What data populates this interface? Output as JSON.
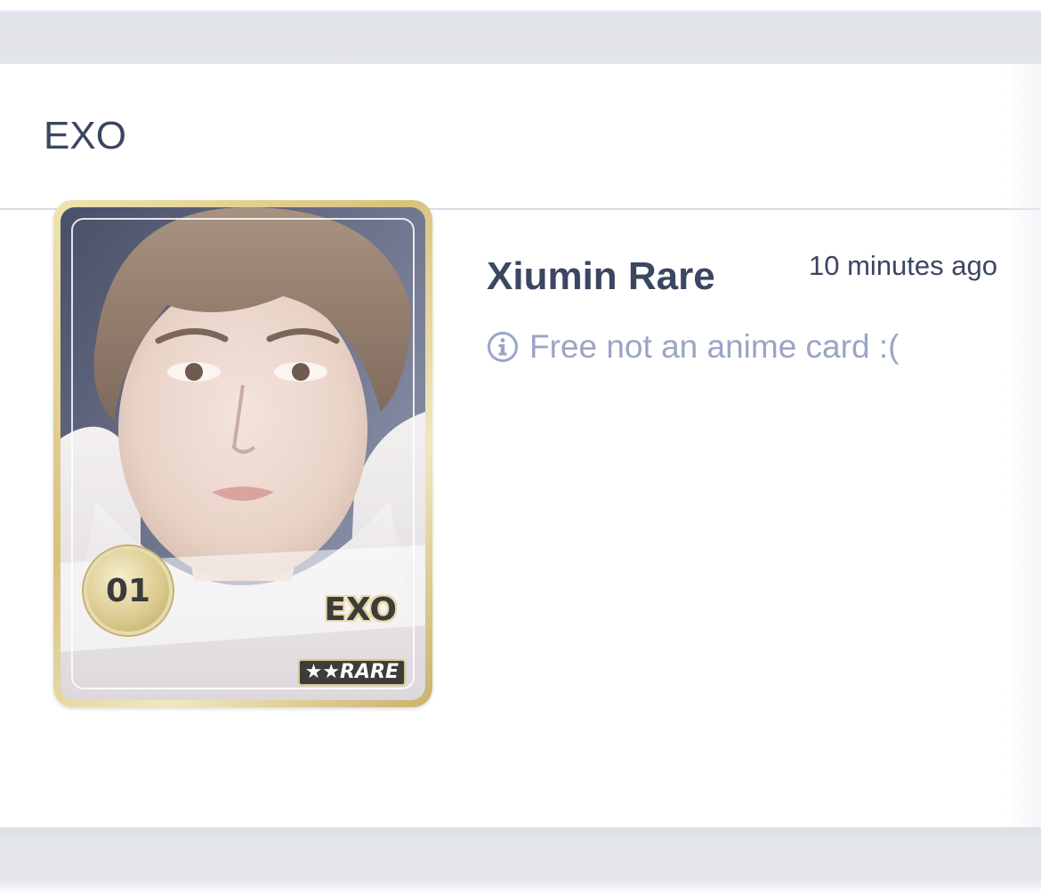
{
  "group": {
    "title": "EXO"
  },
  "card": {
    "name": "Xiumin Rare",
    "timestamp": "10 minutes ago",
    "note": "Free not an anime card :(",
    "note_icon": "info-icon",
    "image": {
      "number": "01",
      "group_label": "EXO",
      "rarity_label": "★★RARE"
    }
  },
  "colors": {
    "text_primary": "#3b4660",
    "text_muted": "#9aa5c6",
    "divider": "#d7dcea",
    "background": "#e4e6ec",
    "panel": "#ffffff"
  }
}
